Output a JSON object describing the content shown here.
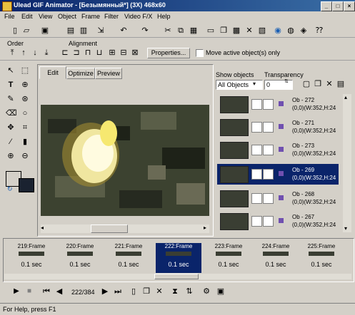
{
  "window": {
    "title": "Ulead GIF Animator - [Безымянный*] (3X) 468x60",
    "min": "_",
    "max": "□",
    "close": "×"
  },
  "menu": [
    "File",
    "Edit",
    "View",
    "Object",
    "Frame",
    "Filter",
    "Video F/X",
    "Help"
  ],
  "order_label": "Order",
  "alignment_label": "Alignment",
  "properties_button": "Properties...",
  "move_active_label": "Move active object(s) only",
  "tabs": [
    "Edit",
    "Optimize",
    "Preview"
  ],
  "objects_panel": {
    "show_label": "Show objects",
    "show_value": "All Objects",
    "transparency_label": "Transparency",
    "transparency_value": "0",
    "items": [
      {
        "name": "Ob - 272",
        "info": "(0,0)(W:352,H:24"
      },
      {
        "name": "Ob - 271",
        "info": "(0,0)(W:352,H:24"
      },
      {
        "name": "Ob - 273",
        "info": "(0,0)(W:352,H:24"
      },
      {
        "name": "Ob - 269",
        "info": "(0,0)(W:352,H:24"
      },
      {
        "name": "Ob - 268",
        "info": "(0,0)(W:352,H:24"
      },
      {
        "name": "Ob - 267",
        "info": "(0,0)(W:352,H:24"
      }
    ]
  },
  "frames": [
    {
      "label": "219:Frame",
      "delay": "0.1 sec"
    },
    {
      "label": "220:Frame",
      "delay": "0.1 sec"
    },
    {
      "label": "221:Frame",
      "delay": "0.1 sec"
    },
    {
      "label": "222:Frame",
      "delay": "0.1 sec"
    },
    {
      "label": "223:Frame",
      "delay": "0.1 sec"
    },
    {
      "label": "224:Frame",
      "delay": "0.1 sec"
    },
    {
      "label": "225:Frame",
      "delay": "0.1 sec"
    }
  ],
  "frame_counter": "222/384",
  "status": "For Help, press F1"
}
